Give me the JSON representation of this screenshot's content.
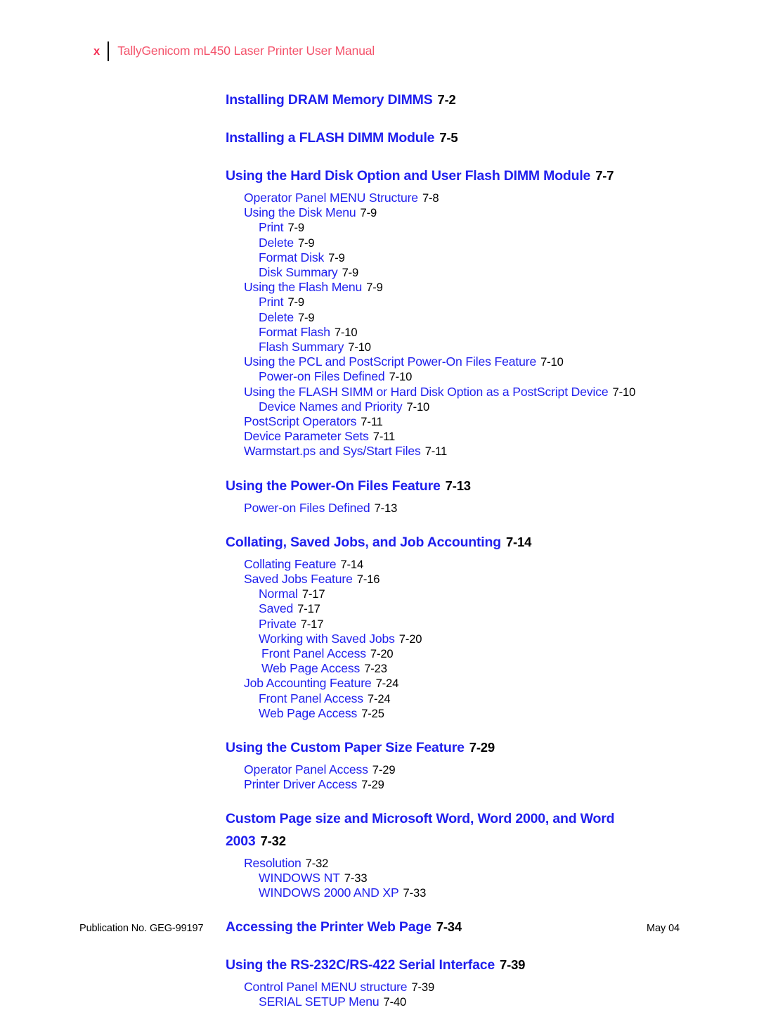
{
  "header": {
    "folio": "x",
    "title": "TallyGenicom mL450 Laser Printer User Manual"
  },
  "colors": {
    "heading_blue": "#1F1FEE",
    "entry_blue": "#1F1FEE",
    "page_number_black": "#000000",
    "header_red": "#F4536B",
    "folio_red": "#F42D52"
  },
  "toc": {
    "entries": [
      {
        "level": 0,
        "label": "Installing DRAM Memory DIMMS",
        "page": "7-2"
      },
      {
        "level": 0,
        "label": "Installing a FLASH DIMM Module",
        "page": "7-5"
      },
      {
        "level": 0,
        "label": "Using the Hard Disk Option and User Flash DIMM Module",
        "page": "7-7"
      },
      {
        "level": 1,
        "label": "Operator Panel MENU Structure",
        "page": "7-8"
      },
      {
        "level": 1,
        "label": "Using the Disk Menu",
        "page": "7-9"
      },
      {
        "level": 2,
        "label": "Print",
        "page": "7-9"
      },
      {
        "level": 2,
        "label": "Delete",
        "page": "7-9"
      },
      {
        "level": 2,
        "label": "Format Disk",
        "page": "7-9"
      },
      {
        "level": 2,
        "label": "Disk Summary",
        "page": "7-9"
      },
      {
        "level": 1,
        "label": "Using the Flash Menu",
        "page": "7-9"
      },
      {
        "level": 2,
        "label": "Print",
        "page": "7-9"
      },
      {
        "level": 2,
        "label": "Delete",
        "page": "7-9"
      },
      {
        "level": 2,
        "label": "Format Flash",
        "page": "7-10"
      },
      {
        "level": 2,
        "label": "Flash Summary",
        "page": "7-10"
      },
      {
        "level": 1,
        "label": "Using the PCL and PostScript Power-On Files Feature",
        "page": "7-10"
      },
      {
        "level": 2,
        "label": "Power-on Files Defined",
        "page": "7-10"
      },
      {
        "level": 1,
        "label": "Using the FLASH SIMM or Hard Disk Option as a PostScript Device",
        "page": "7-10"
      },
      {
        "level": 2,
        "label": "Device Names and Priority",
        "page": "7-10"
      },
      {
        "level": 1,
        "label": "PostScript Operators",
        "page": "7-11"
      },
      {
        "level": 1,
        "label": "Device Parameter Sets",
        "page": "7-11"
      },
      {
        "level": 1,
        "label": "Warmstart.ps and Sys/Start Files",
        "page": "7-11"
      },
      {
        "level": 0,
        "label": "Using the Power-On Files Feature",
        "page": "7-13"
      },
      {
        "level": 1,
        "label": "Power-on Files Defined",
        "page": "7-13"
      },
      {
        "level": 0,
        "label": "Collating, Saved Jobs, and Job Accounting",
        "page": "7-14"
      },
      {
        "level": 1,
        "label": "Collating Feature",
        "page": "7-14"
      },
      {
        "level": 1,
        "label": "Saved Jobs Feature",
        "page": "7-16"
      },
      {
        "level": 2,
        "label": "Normal",
        "page": "7-17"
      },
      {
        "level": 2,
        "label": "Saved",
        "page": "7-17"
      },
      {
        "level": 2,
        "label": "Private",
        "page": "7-17"
      },
      {
        "level": 2,
        "label": "Working with Saved Jobs",
        "page": "7-20"
      },
      {
        "level": 3,
        "label": "Front Panel Access",
        "page": "7-20"
      },
      {
        "level": 3,
        "label": "Web Page Access",
        "page": "7-23"
      },
      {
        "level": 1,
        "label": "Job Accounting Feature",
        "page": "7-24"
      },
      {
        "level": 2,
        "label": "Front Panel Access",
        "page": "7-24"
      },
      {
        "level": 2,
        "label": "Web Page Access",
        "page": "7-25"
      },
      {
        "level": 0,
        "label": "Using the Custom Paper Size Feature",
        "page": "7-29"
      },
      {
        "level": 1,
        "label": "Operator Panel Access",
        "page": "7-29"
      },
      {
        "level": 1,
        "label": "Printer Driver Access",
        "page": "7-29"
      },
      {
        "level": 0,
        "label": "Custom Page size and Microsoft Word, Word 2000, and Word 2003",
        "page": "7-32"
      },
      {
        "level": 1,
        "label": "Resolution",
        "page": "7-32"
      },
      {
        "level": 2,
        "label": "WINDOWS NT",
        "page": "7-33"
      },
      {
        "level": 2,
        "label": "WINDOWS 2000 AND XP",
        "page": "7-33"
      },
      {
        "level": 0,
        "label": "Accessing the Printer Web Page",
        "page": "7-34"
      },
      {
        "level": 0,
        "label": "Using the RS-232C/RS-422 Serial Interface",
        "page": "7-39"
      },
      {
        "level": 1,
        "label": "Control Panel MENU structure",
        "page": "7-39"
      },
      {
        "level": 2,
        "label": "SERIAL SETUP Menu",
        "page": "7-40"
      }
    ]
  },
  "footer": {
    "publication": "Publication No. GEG-99197",
    "date": "May 04"
  }
}
